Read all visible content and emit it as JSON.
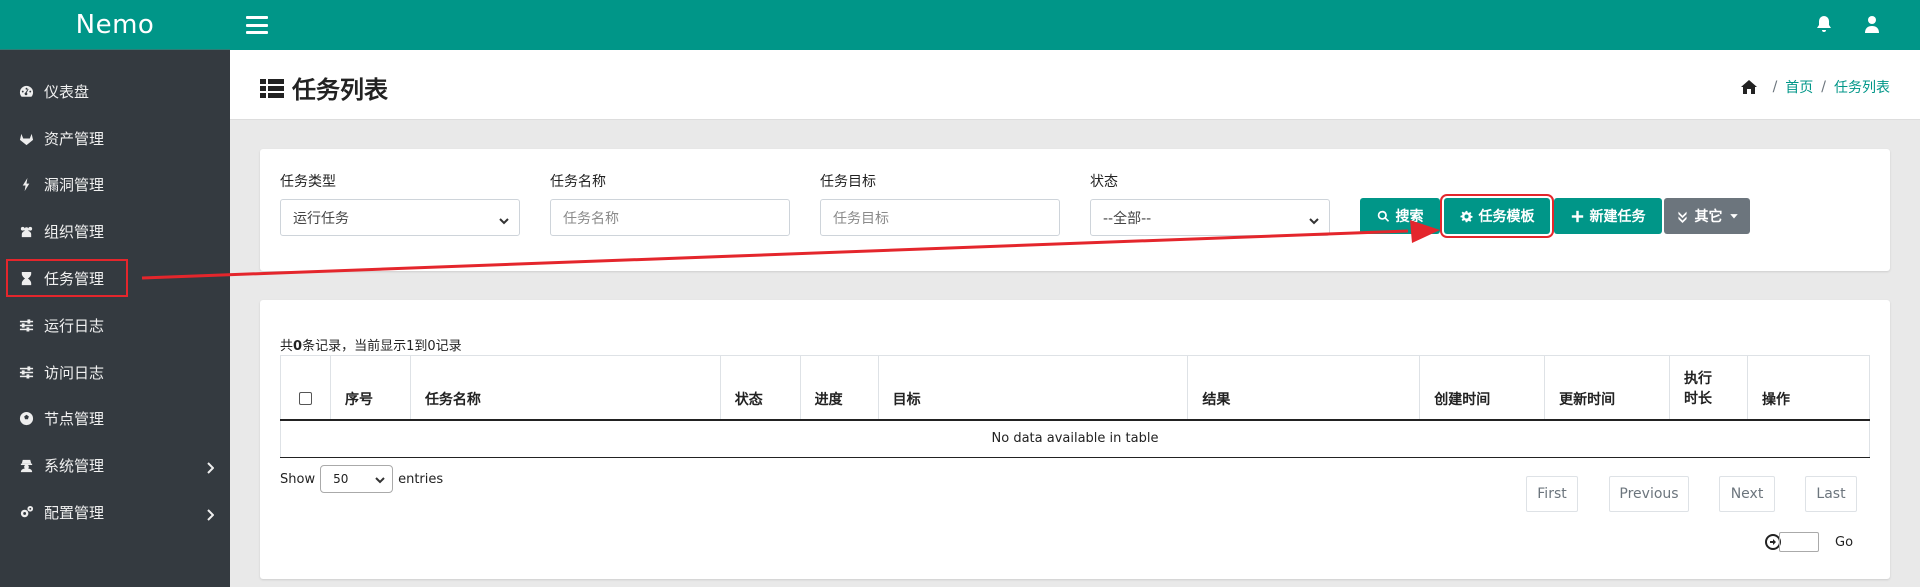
{
  "app": {
    "brand": "Nemo"
  },
  "sidebar": {
    "items": [
      {
        "label": "仪表盘",
        "icon": "dashboard-icon",
        "has_children": false
      },
      {
        "label": "资产管理",
        "icon": "gitlab-icon",
        "has_children": false
      },
      {
        "label": "漏洞管理",
        "icon": "bolt-icon",
        "has_children": false
      },
      {
        "label": "组织管理",
        "icon": "users-icon",
        "has_children": false
      },
      {
        "label": "任务管理",
        "icon": "hourglass-icon",
        "has_children": false,
        "highlighted": true
      },
      {
        "label": "运行日志",
        "icon": "sliders-icon",
        "has_children": false
      },
      {
        "label": "访问日志",
        "icon": "sliders-icon",
        "has_children": false
      },
      {
        "label": "节点管理",
        "icon": "futbol-icon",
        "has_children": false
      },
      {
        "label": "系统管理",
        "icon": "user-secret-icon",
        "has_children": true
      },
      {
        "label": "配置管理",
        "icon": "cogs-icon",
        "has_children": true
      }
    ]
  },
  "header": {
    "title": "任务列表",
    "breadcrumb": {
      "home": "首页",
      "current": "任务列表"
    }
  },
  "filters": {
    "task_type": {
      "label": "任务类型",
      "value": "运行任务"
    },
    "task_name": {
      "label": "任务名称",
      "placeholder": "任务名称"
    },
    "task_target": {
      "label": "任务目标",
      "placeholder": "任务目标"
    },
    "status": {
      "label": "状态",
      "value": "--全部--"
    }
  },
  "buttons": {
    "search": "搜索",
    "template": "任务模板",
    "new_task": "新建任务",
    "other": "其它"
  },
  "table": {
    "info_prefix": "共",
    "info_count": "0",
    "info_suffix": "条记录，当前显示1到0记录",
    "columns": [
      "序号",
      "任务名称",
      "状态",
      "进度",
      "目标",
      "结果",
      "创建时间",
      "更新时间",
      "执行时长",
      "操作"
    ],
    "col_exec_line1": "执行",
    "col_exec_line2": "时长",
    "empty_text": "No data available in table",
    "show_label": "Show",
    "entries_label": "entries",
    "page_size": "50",
    "pager": {
      "first": "First",
      "previous": "Previous",
      "next": "Next",
      "last": "Last"
    },
    "go_label": "Go"
  },
  "colors": {
    "accent": "#009688",
    "sidebar_bg": "#343a40",
    "highlight": "#e4262c"
  }
}
